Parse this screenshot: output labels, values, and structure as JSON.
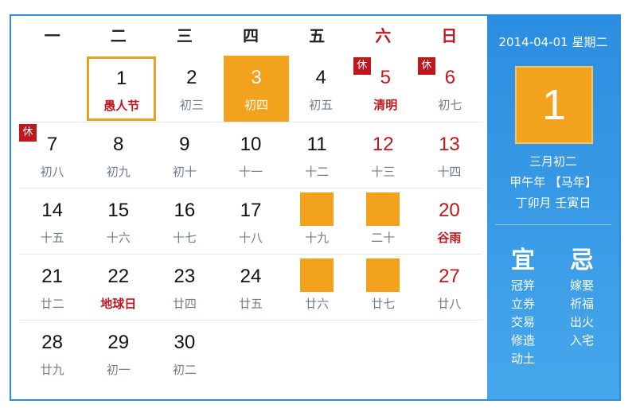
{
  "weekdays": [
    "一",
    "二",
    "三",
    "四",
    "五",
    "六",
    "日"
  ],
  "weeks": [
    [
      {
        "num": "",
        "sub": ""
      },
      {
        "num": "1",
        "sub": "愚人节",
        "festival": true,
        "selected": true
      },
      {
        "num": "2",
        "sub": "初三"
      },
      {
        "num": "3",
        "sub": "初四",
        "today": true
      },
      {
        "num": "4",
        "sub": "初五"
      },
      {
        "num": "5",
        "sub": "清明",
        "festival": true,
        "weekend": true,
        "rest": "休"
      },
      {
        "num": "6",
        "sub": "初七",
        "weekend": true,
        "rest": "休"
      }
    ],
    [
      {
        "num": "7",
        "sub": "初八",
        "rest": "休"
      },
      {
        "num": "8",
        "sub": "初九"
      },
      {
        "num": "9",
        "sub": "初十"
      },
      {
        "num": "10",
        "sub": "十一"
      },
      {
        "num": "11",
        "sub": "十二"
      },
      {
        "num": "12",
        "sub": "十三",
        "weekend": true
      },
      {
        "num": "13",
        "sub": "十四",
        "weekend": true
      }
    ],
    [
      {
        "num": "14",
        "sub": "十五"
      },
      {
        "num": "15",
        "sub": "十六"
      },
      {
        "num": "16",
        "sub": "十七"
      },
      {
        "num": "17",
        "sub": "十八"
      },
      {
        "num": "",
        "sub": "十九",
        "block": true
      },
      {
        "num": "",
        "sub": "二十",
        "block": true
      },
      {
        "num": "20",
        "sub": "谷雨",
        "festival": true,
        "weekend": true
      }
    ],
    [
      {
        "num": "21",
        "sub": "廿二"
      },
      {
        "num": "22",
        "sub": "地球日",
        "festival": true
      },
      {
        "num": "23",
        "sub": "廿四"
      },
      {
        "num": "24",
        "sub": "廿五"
      },
      {
        "num": "",
        "sub": "廿六",
        "block": true
      },
      {
        "num": "",
        "sub": "廿七",
        "block": true
      },
      {
        "num": "27",
        "sub": "廿八",
        "weekend": true
      }
    ],
    [
      {
        "num": "28",
        "sub": "廿九"
      },
      {
        "num": "29",
        "sub": "初一"
      },
      {
        "num": "30",
        "sub": "初二"
      },
      {
        "num": "",
        "sub": ""
      },
      {
        "num": "",
        "sub": ""
      },
      {
        "num": "",
        "sub": ""
      },
      {
        "num": "",
        "sub": ""
      }
    ]
  ],
  "side": {
    "date": "2014-04-01 星期二",
    "day": "1",
    "lunar_date": "三月初二",
    "year": "甲午年 【马年】",
    "ganzhi": "丁卯月 壬寅日",
    "yi_label": "宜",
    "ji_label": "忌",
    "yi": [
      "冠笄",
      "立券",
      "交易",
      "修造",
      "动土"
    ],
    "ji": [
      "嫁娶",
      "祈福",
      "出火",
      "入宅"
    ]
  },
  "colors": {
    "accent": "#f2a21c",
    "red": "#c0161c",
    "blue": "#2f8fdc"
  }
}
